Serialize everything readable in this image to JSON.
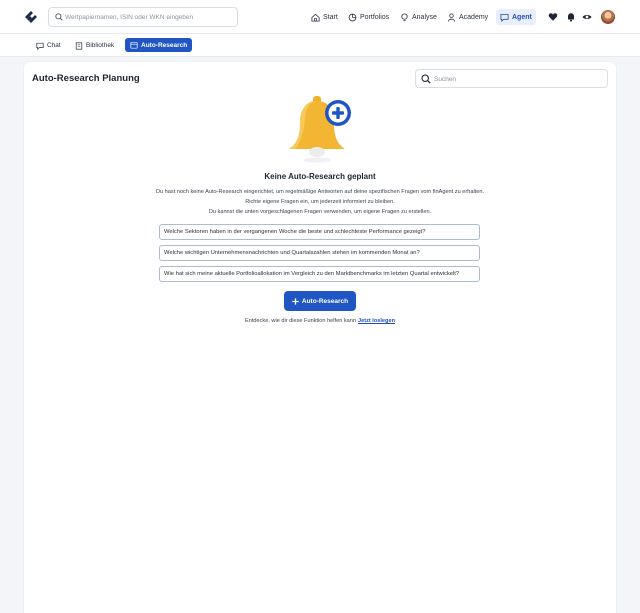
{
  "topbar": {
    "search_placeholder": "Wertpapiernamen, ISIN oder WKN eingeben",
    "nav": [
      {
        "label": "Start",
        "icon": "home-icon"
      },
      {
        "label": "Portfolios",
        "icon": "pie-chart-icon"
      },
      {
        "label": "Analyse",
        "icon": "lightbulb-icon"
      },
      {
        "label": "Academy",
        "icon": "academy-icon"
      },
      {
        "label": "Agent",
        "icon": "chat-icon",
        "active": true
      }
    ],
    "icons": [
      "heart-icon",
      "bell-icon",
      "eye-icon",
      "avatar"
    ]
  },
  "subtabs": [
    {
      "label": "Chat",
      "icon": "chat-icon"
    },
    {
      "label": "Bibliothek",
      "icon": "book-icon"
    },
    {
      "label": "Auto-Research",
      "icon": "calendar-icon",
      "active": true
    }
  ],
  "main": {
    "title": "Auto-Research Planung",
    "search_placeholder": "Suchen",
    "empty_title": "Keine Auto-Research geplant",
    "desc_line1": "Du hast noch keine Auto-Research eingerichtet, um regelmäßige Antworten auf deine spezifischen Fragen vom finAgent zu erhalten.",
    "desc_line2": "Richte eigene Fragen ein, um jederzeit informiert zu bleiben.",
    "desc_line3": "Du kannst die unten vorgeschlagenen Fragen verwenden, um eigene Fragen zu erstellen.",
    "suggestions": [
      "Welche Sektoren haben in der vergangenen Woche die beste und schlechteste Performance gezeigt?",
      "Welche wichtigen Unternehmensnachrichten und Quartalszahlen stehen im kommenden Monat an?",
      "Wie hat sich meine aktuelle Portfolioallokation im Vergleich zu den Marktbenchmarks im letzten Quartal entwickelt?"
    ],
    "cta_label": "Auto-Research",
    "discover_text": "Entdecke, wie dir diese Funktion helfen kann",
    "discover_link": "Jetzt loslegen"
  },
  "colors": {
    "accent": "#1f56c4",
    "bell": "#f2b632",
    "plus_badge": "#1f56c4"
  }
}
